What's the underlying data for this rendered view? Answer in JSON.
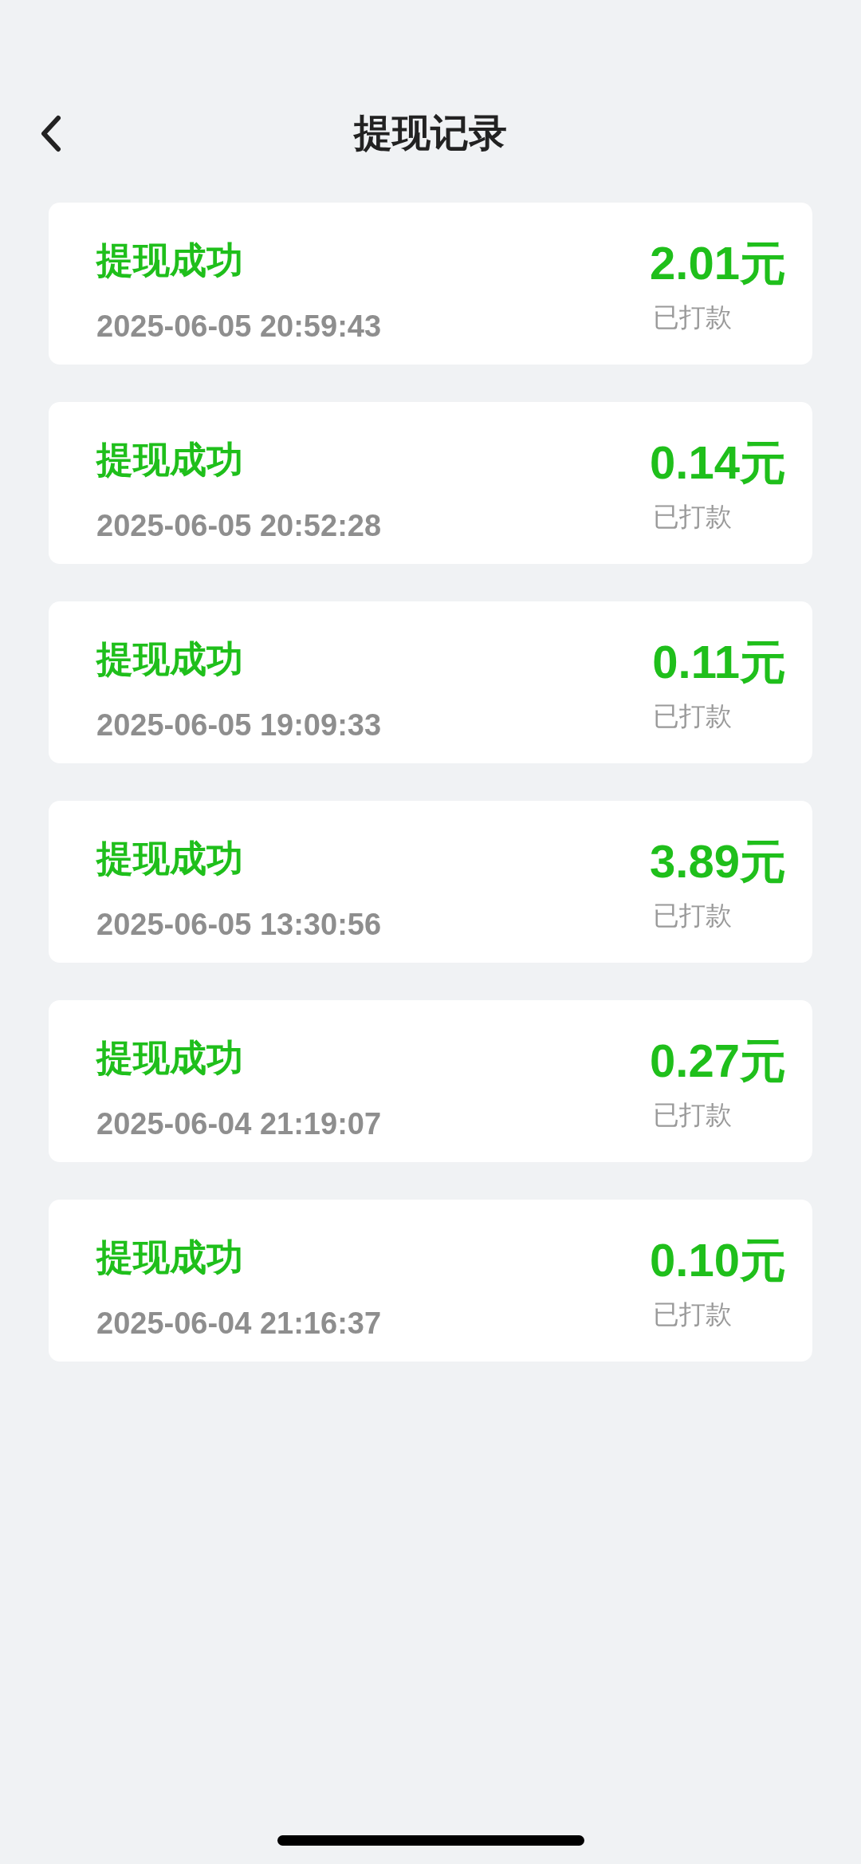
{
  "header": {
    "title": "提现记录"
  },
  "records": [
    {
      "status": "提现成功",
      "time": "2025-06-05 20:59:43",
      "amount": "2.01元",
      "payout": "已打款"
    },
    {
      "status": "提现成功",
      "time": "2025-06-05 20:52:28",
      "amount": "0.14元",
      "payout": "已打款"
    },
    {
      "status": "提现成功",
      "time": "2025-06-05 19:09:33",
      "amount": "0.11元",
      "payout": "已打款"
    },
    {
      "status": "提现成功",
      "time": "2025-06-05 13:30:56",
      "amount": "3.89元",
      "payout": "已打款"
    },
    {
      "status": "提现成功",
      "time": "2025-06-04 21:19:07",
      "amount": "0.27元",
      "payout": "已打款"
    },
    {
      "status": "提现成功",
      "time": "2025-06-04 21:16:37",
      "amount": "0.10元",
      "payout": "已打款"
    }
  ]
}
